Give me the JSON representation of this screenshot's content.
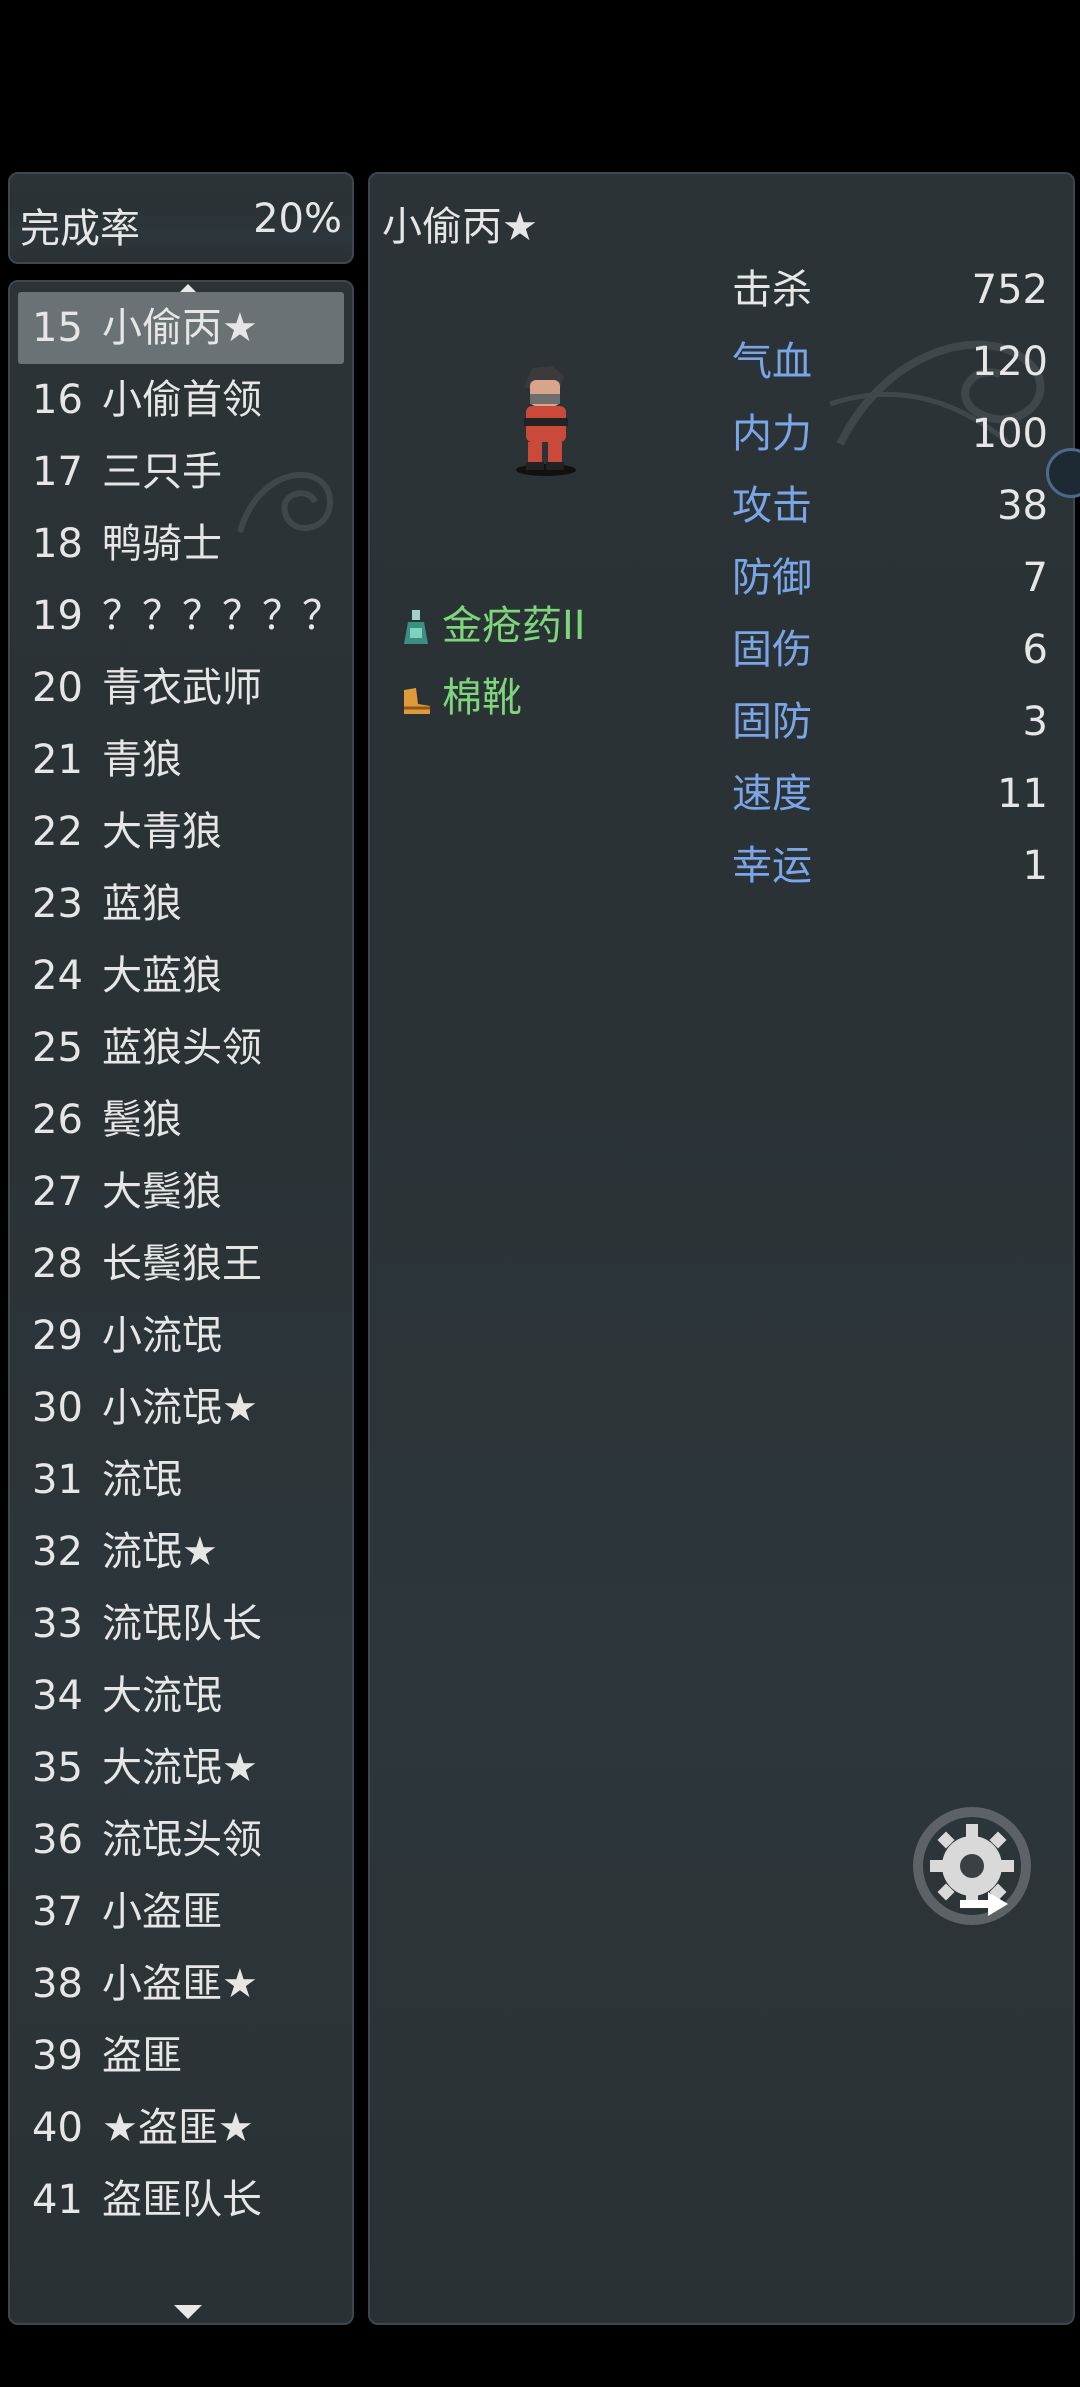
{
  "completion": {
    "label": "完成率",
    "value": "20%"
  },
  "list": {
    "items": [
      {
        "num": "15",
        "name": "小偷丙★",
        "selected": true
      },
      {
        "num": "16",
        "name": "小偷首领"
      },
      {
        "num": "17",
        "name": "三只手"
      },
      {
        "num": "18",
        "name": "鸭骑士"
      },
      {
        "num": "19",
        "name": "？？？？？？"
      },
      {
        "num": "20",
        "name": "青衣武师"
      },
      {
        "num": "21",
        "name": "青狼"
      },
      {
        "num": "22",
        "name": "大青狼"
      },
      {
        "num": "23",
        "name": "蓝狼"
      },
      {
        "num": "24",
        "name": "大蓝狼"
      },
      {
        "num": "25",
        "name": "蓝狼头领"
      },
      {
        "num": "26",
        "name": "鬓狼"
      },
      {
        "num": "27",
        "name": "大鬓狼"
      },
      {
        "num": "28",
        "name": "长鬓狼王"
      },
      {
        "num": "29",
        "name": "小流氓"
      },
      {
        "num": "30",
        "name": "小流氓★"
      },
      {
        "num": "31",
        "name": "流氓"
      },
      {
        "num": "32",
        "name": "流氓★"
      },
      {
        "num": "33",
        "name": "流氓队长"
      },
      {
        "num": "34",
        "name": "大流氓"
      },
      {
        "num": "35",
        "name": "大流氓★"
      },
      {
        "num": "36",
        "name": "流氓头领"
      },
      {
        "num": "37",
        "name": "小盗匪"
      },
      {
        "num": "38",
        "name": "小盗匪★"
      },
      {
        "num": "39",
        "name": "盗匪"
      },
      {
        "num": "40",
        "name": "★盗匪★"
      },
      {
        "num": "41",
        "name": "盗匪队长"
      }
    ]
  },
  "detail": {
    "title": "小偷丙★",
    "stats": [
      {
        "label": "击杀",
        "value": "752",
        "color": "#e6e6e6"
      },
      {
        "label": "气血",
        "value": "120",
        "color": "#7aa6e8"
      },
      {
        "label": "内力",
        "value": "100",
        "color": "#7aa6e8"
      },
      {
        "label": "攻击",
        "value": "38",
        "color": "#7aa6e8"
      },
      {
        "label": "防御",
        "value": "7",
        "color": "#7aa6e8"
      },
      {
        "label": "固伤",
        "value": "6",
        "color": "#7aa6e8"
      },
      {
        "label": "固防",
        "value": "3",
        "color": "#7aa6e8"
      },
      {
        "label": "速度",
        "value": "11",
        "color": "#7aa6e8"
      },
      {
        "label": "幸运",
        "value": "1",
        "color": "#7aa6e8"
      }
    ],
    "drops": [
      {
        "name": "金疮药II",
        "icon": "potion-icon"
      },
      {
        "name": "棉靴",
        "icon": "boot-icon"
      }
    ]
  },
  "colors": {
    "drop_text": "#7ed67a",
    "stat_blue": "#7aa6e8",
    "selected_bg": "#6b7276"
  }
}
